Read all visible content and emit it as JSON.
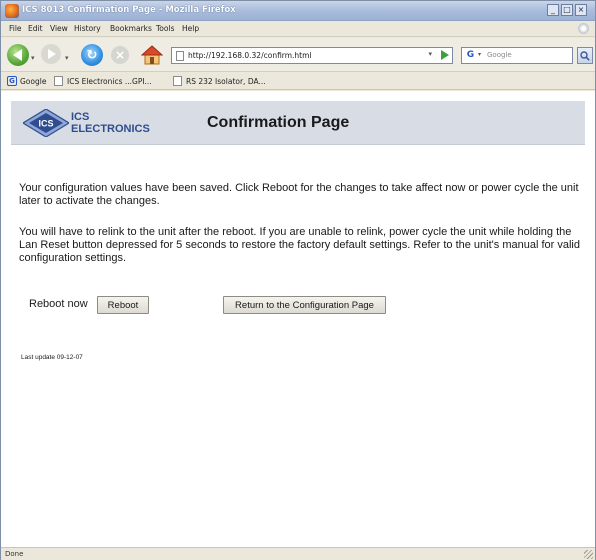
{
  "window": {
    "title": "ICS 8013 Confirmation Page - Mozilla Firefox",
    "controls": {
      "minimize": "_",
      "maximize": "□",
      "close": "×"
    }
  },
  "menubar": {
    "items": [
      "File",
      "Edit",
      "View",
      "History",
      "Bookmarks",
      "Tools",
      "Help"
    ]
  },
  "navbar": {
    "url": "http://192.168.0.32/confirm.html",
    "search_placeholder": "Google",
    "search_engine_icon": "G"
  },
  "bookmarks": {
    "items": [
      "Google",
      "ICS Electronics ...GPI...",
      "RS 232 Isolator, DA..."
    ]
  },
  "page": {
    "logo_line1": "ICS",
    "logo_line2": "ELECTRONICS",
    "logo_badge": "ICS",
    "title": "Confirmation Page",
    "paragraph1": "Your configuration values have been saved. Click Reboot for the changes to take affect now or power cycle the unit later to activate the changes.",
    "paragraph2": "You will have to relink to the unit after the reboot. If you are unable to relink, power cycle the unit while holding the Lan Reset button depressed for 5 seconds to restore the factory default settings. Refer to the unit's manual for valid configuration settings.",
    "reboot_label": "Reboot now",
    "reboot_button": "Reboot",
    "return_button": "Return to the Configuration Page",
    "last_update": "Last update 09-12-07"
  },
  "statusbar": {
    "text": "Done"
  },
  "colors": {
    "banner": "#d8dde5",
    "logo_blue": "#2f4d8e",
    "titlebar": "#a9bcdb"
  }
}
